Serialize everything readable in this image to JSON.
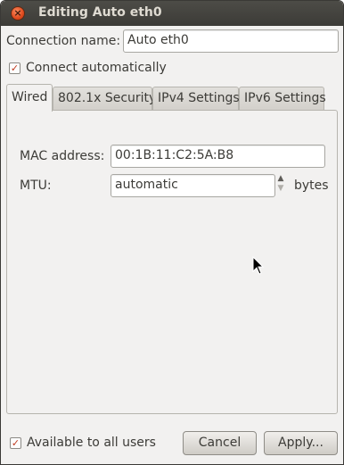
{
  "window": {
    "title": "Editing Auto eth0"
  },
  "connection": {
    "name_label": "Connection name:",
    "name_value": "Auto eth0"
  },
  "connect_auto": {
    "label": "Connect automatically",
    "checked": true
  },
  "tabs": [
    {
      "label": "Wired",
      "active": true
    },
    {
      "label": "802.1x Security",
      "active": false
    },
    {
      "label": "IPv4 Settings",
      "active": false
    },
    {
      "label": "IPv6 Settings",
      "active": false
    }
  ],
  "wired": {
    "mac_label": "MAC address:",
    "mac_value": "00:1B:11:C2:5A:B8",
    "mtu_label": "MTU:",
    "mtu_value": "automatic",
    "mtu_unit": "bytes"
  },
  "footer": {
    "available_label": "Available to all users",
    "available_checked": true,
    "cancel_label": "Cancel",
    "apply_label": "Apply..."
  },
  "icons": {
    "close": "close-icon",
    "check": "checkmark-icon",
    "spin_up": "spin-up-icon",
    "spin_down": "spin-down-icon",
    "cursor": "mouse-pointer-icon"
  },
  "colors": {
    "titlebar": "#3c3b37",
    "close": "#df4a1e",
    "check": "#c0391e",
    "window_bg": "#f2f1f0"
  }
}
